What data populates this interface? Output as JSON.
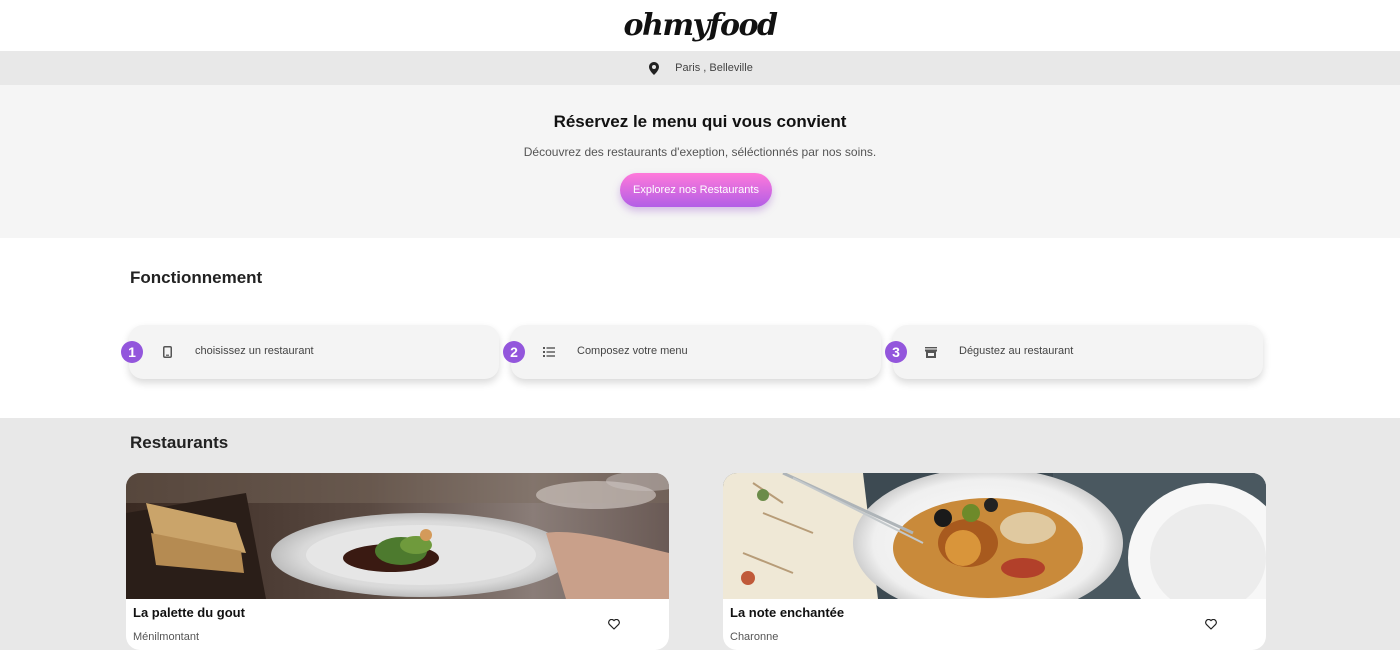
{
  "header": {
    "logo": "ohmyfood",
    "location": "Paris , Belleville",
    "location_icon": "map-pin-icon"
  },
  "hero": {
    "title": "Réservez le menu qui vous convient",
    "subtitle": "Découvrez des restaurants d'exeption, séléctionnés par nos soins.",
    "cta_label": "Explorez nos Restaurants"
  },
  "how_it_works": {
    "title": "Fonctionnement",
    "steps": [
      {
        "number": "1",
        "icon": "mobile-phone-icon",
        "label": "choisissez un restaurant"
      },
      {
        "number": "2",
        "icon": "list-icon",
        "label": "Composez votre menu"
      },
      {
        "number": "3",
        "icon": "store-icon",
        "label": "Dégustez au restaurant"
      }
    ]
  },
  "restaurants": {
    "title": "Restaurants",
    "items": [
      {
        "name": "La palette du gout",
        "location": "Ménilmontant",
        "icon": "heart-icon"
      },
      {
        "name": "La note enchantée",
        "location": "Charonne",
        "icon": "heart-icon"
      }
    ]
  },
  "colors": {
    "accent_start": "#ff79da",
    "accent_end": "#9356dc"
  }
}
